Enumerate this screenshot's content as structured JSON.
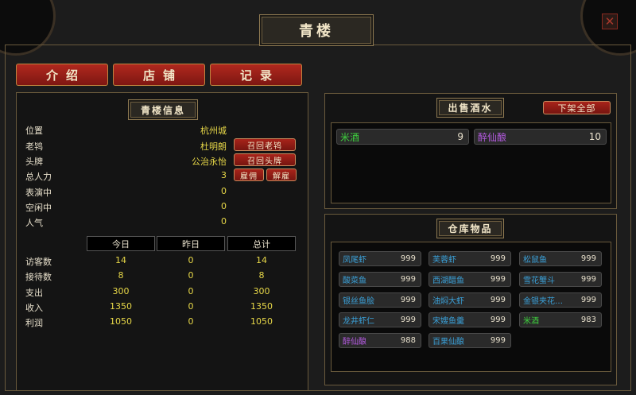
{
  "title": "青楼",
  "close_icon_glyph": "✕",
  "tabs": [
    {
      "label": "介绍"
    },
    {
      "label": "店铺"
    },
    {
      "label": "记录"
    }
  ],
  "info": {
    "heading": "青楼信息",
    "rows": [
      {
        "label": "位置",
        "value": "杭州城"
      },
      {
        "label": "老鸨",
        "value": "杜明朗"
      },
      {
        "label": "头牌",
        "value": "公治永怡"
      },
      {
        "label": "总人力",
        "value": "3"
      },
      {
        "label": "表演中",
        "value": "0"
      },
      {
        "label": "空闲中",
        "value": "0"
      },
      {
        "label": "人气",
        "value": "0"
      }
    ],
    "buttons": {
      "recall_madam": "召回老鸨",
      "recall_top": "召回头牌",
      "hire": "雇佣",
      "fire": "解雇"
    },
    "stats": {
      "headers": [
        "今日",
        "昨日",
        "总计"
      ],
      "rows": [
        {
          "label": "访客数",
          "values": [
            "14",
            "0",
            "14"
          ]
        },
        {
          "label": "接待数",
          "values": [
            "8",
            "0",
            "8"
          ]
        },
        {
          "label": "支出",
          "values": [
            "300",
            "0",
            "300"
          ]
        },
        {
          "label": "收入",
          "values": [
            "1350",
            "0",
            "1350"
          ]
        },
        {
          "label": "利润",
          "values": [
            "1050",
            "0",
            "1050"
          ]
        }
      ]
    }
  },
  "wine": {
    "heading": "出售酒水",
    "remove_all": "下架全部",
    "items": [
      {
        "name": "米酒",
        "count": "9",
        "color": "#3fd23f"
      },
      {
        "name": "醉仙酿",
        "count": "10",
        "color": "#b45ae0"
      }
    ]
  },
  "storage": {
    "heading": "仓库物品",
    "items": [
      {
        "name": "凤尾虾",
        "count": "999",
        "color": "#3aa0d8"
      },
      {
        "name": "芙蓉虾",
        "count": "999",
        "color": "#3aa0d8"
      },
      {
        "name": "松鼠鱼",
        "count": "999",
        "color": "#3aa0d8"
      },
      {
        "name": "酸菜鱼",
        "count": "999",
        "color": "#3aa0d8"
      },
      {
        "name": "西湖醋鱼",
        "count": "999",
        "color": "#3aa0d8"
      },
      {
        "name": "雪花蟹斗",
        "count": "999",
        "color": "#3aa0d8"
      },
      {
        "name": "银丝鱼脍",
        "count": "999",
        "color": "#3aa0d8"
      },
      {
        "name": "油焖大虾",
        "count": "999",
        "color": "#3aa0d8"
      },
      {
        "name": "金银夹花…",
        "count": "999",
        "color": "#3aa0d8"
      },
      {
        "name": "龙井虾仁",
        "count": "999",
        "color": "#3aa0d8"
      },
      {
        "name": "宋嫂鱼羹",
        "count": "999",
        "color": "#3aa0d8"
      },
      {
        "name": "米酒",
        "count": "983",
        "color": "#3fd23f"
      },
      {
        "name": "醉仙酿",
        "count": "988",
        "color": "#b45ae0"
      },
      {
        "name": "百果仙酿",
        "count": "999",
        "color": "#3aa0d8"
      }
    ]
  }
}
